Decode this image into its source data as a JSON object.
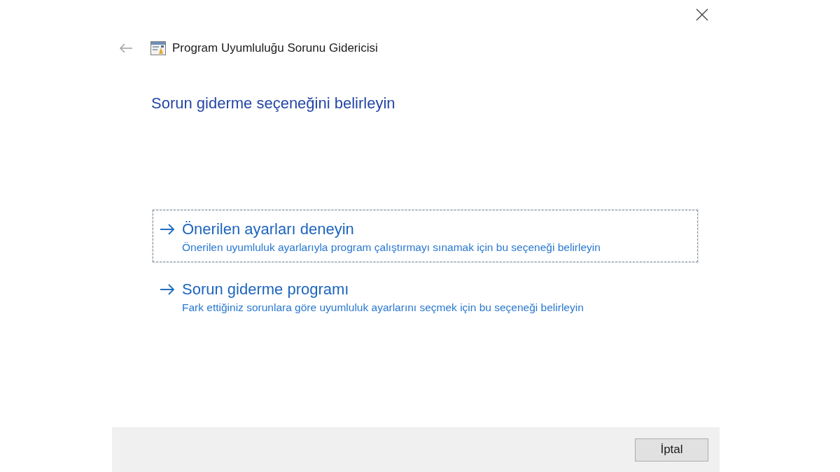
{
  "window": {
    "title": "Program Uyumluluğu Sorunu Gidericisi"
  },
  "heading": "Sorun giderme seçeneğini belirleyin",
  "options": [
    {
      "title": "Önerilen ayarları deneyin",
      "description": "Önerilen uyumluluk ayarlarıyla program çalıştırmayı sınamak için bu seçeneği belirleyin",
      "focused": true
    },
    {
      "title": "Sorun giderme programı",
      "description": "Fark ettiğiniz sorunlara göre uyumluluk ayarlarını seçmek için bu seçeneği belirleyin",
      "focused": false
    }
  ],
  "buttons": [
    "İptal"
  ]
}
